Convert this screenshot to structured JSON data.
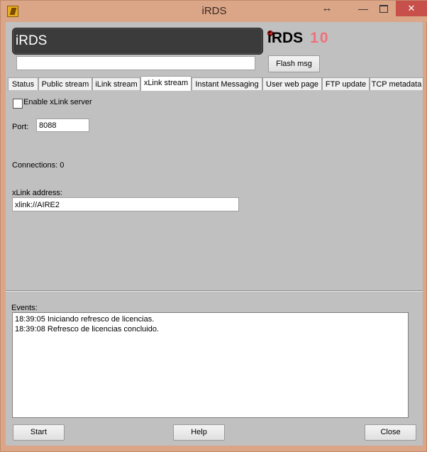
{
  "window": {
    "title": "iRDS"
  },
  "header": {
    "name": "iRDS",
    "logo_text": "iRDS",
    "logo_version": "10",
    "flash_input_value": "",
    "flash_button": "Flash msg"
  },
  "tabs": [
    {
      "label": "Status"
    },
    {
      "label": "Public stream"
    },
    {
      "label": "iLink stream"
    },
    {
      "label": "xLink stream",
      "active": true
    },
    {
      "label": "Instant Messaging"
    },
    {
      "label": "User web page"
    },
    {
      "label": "FTP update"
    },
    {
      "label": "TCP metadata"
    }
  ],
  "xlink": {
    "enable_label": "Enable xLink server",
    "enable_checked": false,
    "port_label": "Port:",
    "port_value": "8088",
    "connections_text": "Connections: 0",
    "address_label": "xLink address:",
    "address_value": "xlink://AIRE2"
  },
  "events": {
    "label": "Events:",
    "lines": [
      "18:39:05 Iniciando refresco de licencias.",
      "18:39:08 Refresco de licencias concluido."
    ]
  },
  "buttons": {
    "start": "Start",
    "help": "Help",
    "close": "Close"
  },
  "colors": {
    "frame": "#dba588",
    "client_bg": "#c0c0c0",
    "header_bg": "#3b3b3b",
    "logo_version": "#f0707a",
    "close_button": "#c7504a"
  }
}
